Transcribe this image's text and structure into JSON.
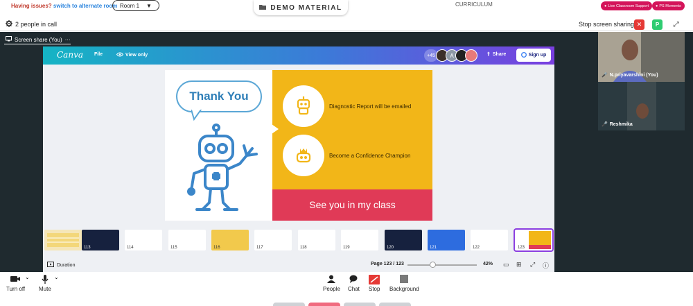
{
  "topbar": {
    "issue_label": "Having issues?",
    "alternate_room_link": "switch to alternate room",
    "room_select": "Room 1",
    "demo_material": "DEMO MATERIAL",
    "curriculum": "CURRICULUM",
    "live_support": "Live Classroom Support",
    "ps_moments": "PS Moments"
  },
  "callbar": {
    "people_in_call": "2 people in call",
    "stop_sharing": "Stop screen sharing",
    "p_button": "P"
  },
  "screen_share_tab": "Screen share (You)",
  "canva": {
    "logo": "Canva",
    "file_menu": "File",
    "view_only": "View only",
    "avatar_count": "+45",
    "avatar_letter": "A",
    "share": "Share",
    "sign_up": "Sign up",
    "duration": "Duration",
    "page_count": "Page 123 / 123",
    "zoom": "42%"
  },
  "slide": {
    "title": "Thank You",
    "item1": "Diagnostic Report will be emailed",
    "item2": "Become a Confidence Champion",
    "footer": "See you in my class",
    "colors": {
      "yellow": "#f2b618",
      "red": "#e03a57",
      "blue": "#5ba7d6"
    }
  },
  "thumbnails": [
    "",
    "113",
    "114",
    "115",
    "116",
    "117",
    "118",
    "119",
    "120",
    "121",
    "122",
    "123"
  ],
  "participants": [
    {
      "name": "N.priyavarshini (You)"
    },
    {
      "name": "Reshmika"
    }
  ],
  "bottombar": {
    "turn_off": "Turn off",
    "mute": "Mute",
    "people": "People",
    "chat": "Chat",
    "stop": "Stop",
    "background": "Background"
  }
}
